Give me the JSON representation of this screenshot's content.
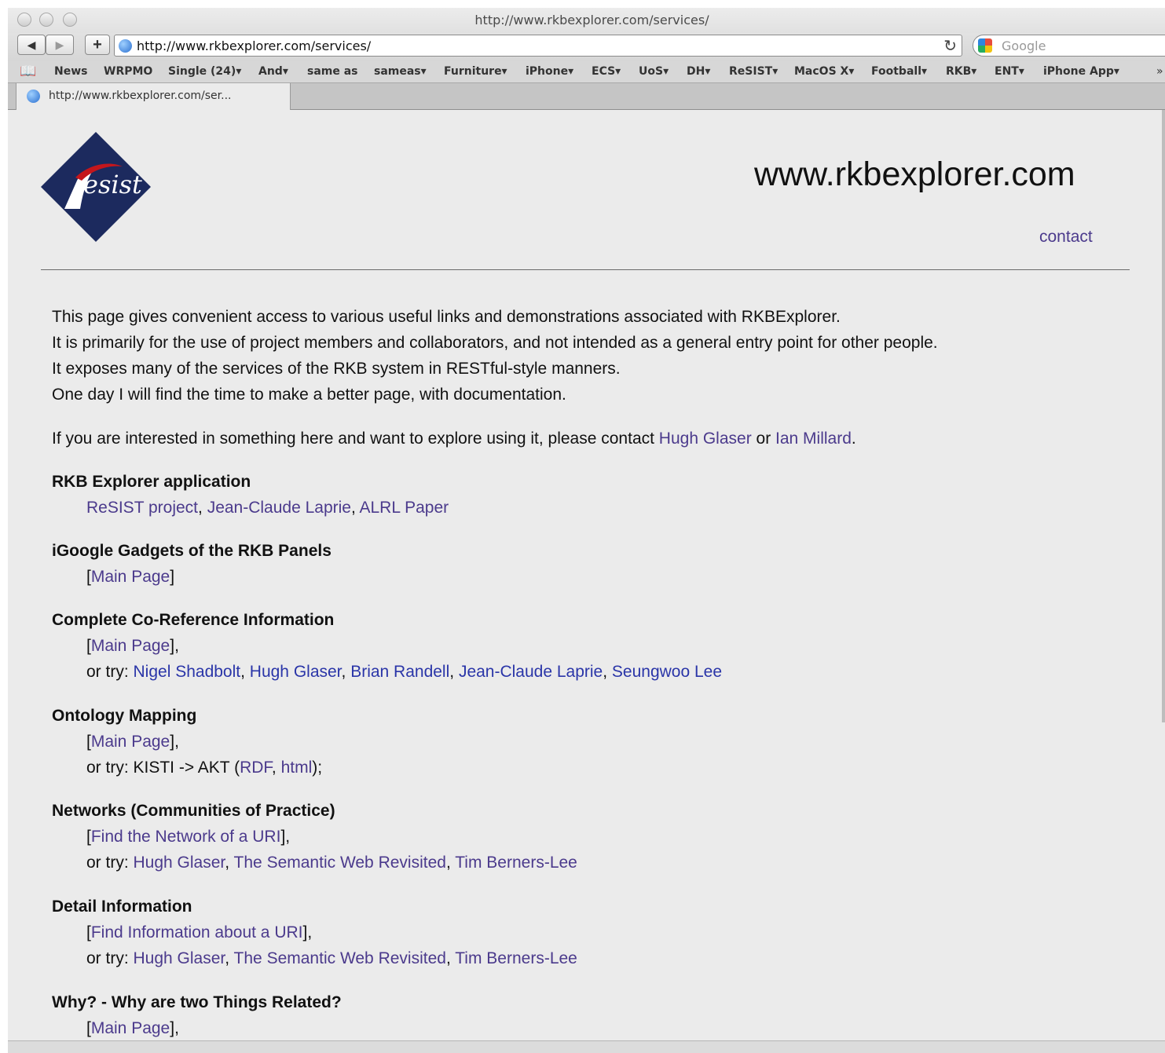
{
  "window": {
    "title": "http://www.rkbexplorer.com/services/"
  },
  "toolbar": {
    "back_label": "◀",
    "forward_label": "▶",
    "add_label": "+",
    "url": "http://www.rkbexplorer.com/services/",
    "reload_label": "↻",
    "search_placeholder": "Google"
  },
  "bookmarks": [
    "News",
    "WRPMO",
    "Single (24)▾",
    "And▾",
    "same as",
    "sameas▾",
    "Furniture▾",
    "iPhone▾",
    "ECS▾",
    "UoS▾",
    "DH▾",
    "ReSIST▾",
    "MacOS X▾",
    "Football▾",
    "RKB▾",
    "ENT▾",
    "iPhone App▾"
  ],
  "bookmarks_overflow": "»",
  "tab": {
    "label": "http://www.rkbexplorer.com/ser..."
  },
  "page": {
    "logo_text": "esist",
    "site_title": "www.rkbexplorer.com",
    "contact": "contact",
    "intro": [
      "This page gives convenient access to various useful links and demonstrations associated with RKBExplorer.",
      "It is primarily for the use of project members and collaborators, and not intended as a general entry point for other people.",
      "It exposes many of the services of the RKB system in RESTful-style manners.",
      "One day I will find the time to make a better page, with documentation."
    ],
    "interest": {
      "prefix": "If you are interested in something here and want to explore using it, please contact ",
      "contact1": "Hugh Glaser",
      "or": " or ",
      "contact2": "Ian Millard",
      "suffix": "."
    },
    "sections": {
      "rkb": {
        "heading": "RKB Explorer application",
        "links": [
          "ReSIST project",
          "Jean-Claude Laprie",
          "ALRL Paper"
        ]
      },
      "igoogle": {
        "heading": "iGoogle Gadgets of the RKB Panels",
        "main": "Main Page"
      },
      "coref": {
        "heading": "Complete Co-Reference Information",
        "main": "Main Page",
        "try_label": "or try: ",
        "people": [
          "Nigel Shadbolt",
          "Hugh Glaser",
          "Brian Randell",
          "Jean-Claude Laprie",
          "Seungwoo Lee"
        ]
      },
      "onto": {
        "heading": "Ontology Mapping",
        "main": "Main Page",
        "try_label": "or try: KISTI -> AKT (",
        "rdf": "RDF",
        "html": "html",
        "try_end": ");"
      },
      "networks": {
        "heading": "Networks (Communities of Practice)",
        "main": "Find the Network of a URI",
        "try_label": "or try: ",
        "items": [
          "Hugh Glaser",
          "The Semantic Web Revisited",
          "Tim Berners-Lee"
        ]
      },
      "detail": {
        "heading": "Detail Information",
        "main": "Find Information about a URI",
        "try_label": "or try: ",
        "items": [
          "Hugh Glaser",
          "The Semantic Web Revisited",
          "Tim Berners-Lee"
        ]
      },
      "why": {
        "heading": "Why? - Why are two Things Related?",
        "main": "Main Page"
      }
    }
  }
}
